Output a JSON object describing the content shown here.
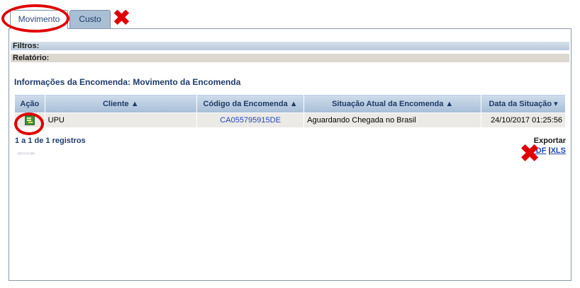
{
  "tabs": [
    {
      "label": "Movimento",
      "active": true
    },
    {
      "label": "Custo",
      "active": false
    }
  ],
  "bars": {
    "filtros": "Filtros:",
    "relatorio": "Relatório:"
  },
  "section_title": "Informações da Encomenda: Movimento da Encomenda",
  "table": {
    "headers": [
      "Ação",
      "Cliente ▲",
      "Código da Encomenda ▲",
      "Situação Atual da Encomenda ▲",
      "Data da Situação ▾"
    ],
    "rows": [
      {
        "acao_icon": "document-icon",
        "cliente": "UPU",
        "codigo": "CA055795915DE",
        "situacao": "Aguardando Chegada no Brasil",
        "data": "24/10/2017 01:25:56"
      }
    ]
  },
  "registros": "1 a 1 de 1 registros",
  "pager": "«« «  » »»",
  "export": {
    "label": "Exportar",
    "pdf": "PDF",
    "separator": " |",
    "xls": "XLS"
  },
  "annotations": {
    "x_mark": "✖",
    "color": "#e00000"
  },
  "colors": {
    "header_bg": "#a7bfd8",
    "link": "#2246b6",
    "title": "#1f3c6b"
  }
}
